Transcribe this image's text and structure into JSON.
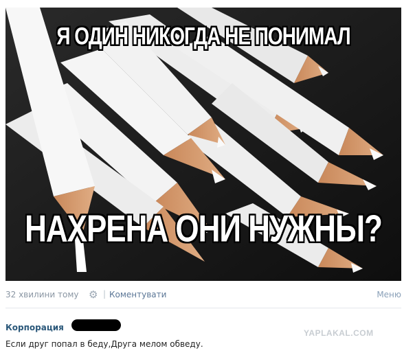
{
  "post": {
    "image_caption_top": "Я ОДИН НИКОГДА НЕ ПОНИМАЛ",
    "image_caption_bottom": "НАХРЕНА ОНИ НУЖНЫ?",
    "image_subject": "white pencils with wooden sharpened tips"
  },
  "meta": {
    "time": "32 хвилини тому",
    "comment_link": "Коментувати",
    "menu": "Меню",
    "separator": "|"
  },
  "comment": {
    "author": "Корпорация",
    "text": "Если друг попал в беду,Друга мелом обведу."
  },
  "watermark": "YAPLAKAL.COM",
  "icons": {
    "settings": "gear-icon"
  }
}
